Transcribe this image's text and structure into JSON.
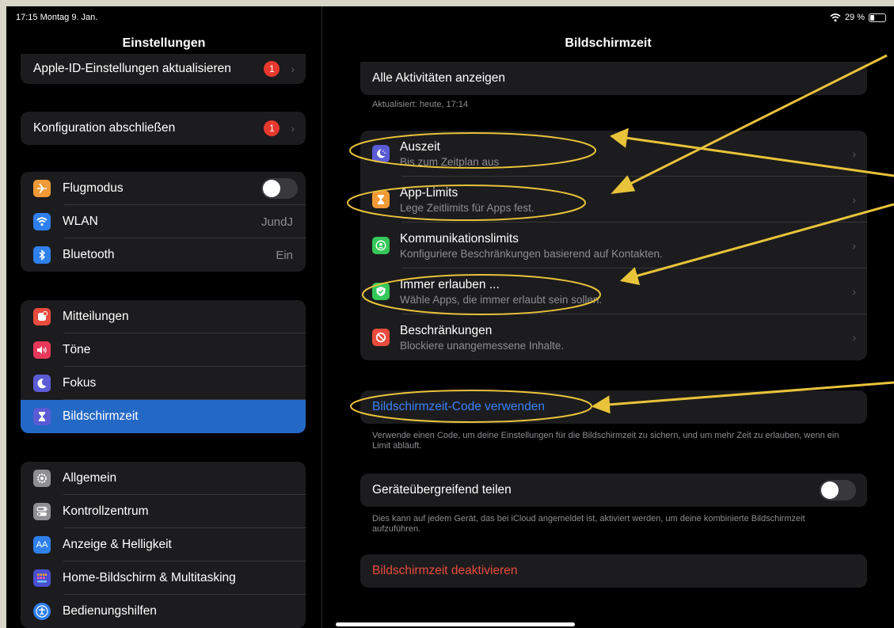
{
  "status": {
    "time": "17:15  Montag 9. Jan.",
    "battery": "29 %",
    "battery_level": 0.29
  },
  "sidebar": {
    "title": "Einstellungen",
    "apple_id": {
      "label": "Apple-ID-Einstellungen aktualisieren",
      "badge": "1"
    },
    "config": {
      "label": "Konfiguration abschließen",
      "badge": "1"
    },
    "connectivity": [
      {
        "label": "Flugmodus",
        "icon": "airplane-icon",
        "color": "#f19a37",
        "value": ""
      },
      {
        "label": "WLAN",
        "icon": "wifi-icon",
        "color": "#2f80ed",
        "value": "JundJ"
      },
      {
        "label": "Bluetooth",
        "icon": "bluetooth-icon",
        "color": "#2f80ed",
        "value": "Ein"
      }
    ],
    "notifications": [
      {
        "label": "Mitteilungen",
        "icon": "bell-icon",
        "color": "#e94b3c"
      },
      {
        "label": "Töne",
        "icon": "speaker-icon",
        "color": "#e9395a"
      },
      {
        "label": "Fokus",
        "icon": "moon-icon",
        "color": "#5b5bd6"
      },
      {
        "label": "Bildschirmzeit",
        "icon": "hourglass-icon",
        "color": "#5b5bd6"
      }
    ],
    "general": [
      {
        "label": "Allgemein",
        "icon": "gear-icon",
        "color": "#8e8e93"
      },
      {
        "label": "Kontrollzentrum",
        "icon": "switches-icon",
        "color": "#8e8e93"
      },
      {
        "label": "Anzeige & Helligkeit",
        "icon": "aa-icon",
        "color": "#2f80ed",
        "glyph": "AA"
      },
      {
        "label": "Home-Bildschirm & Multitasking",
        "icon": "grid-icon",
        "color": "#4a4fd1"
      },
      {
        "label": "Bedienungshilfen",
        "icon": "accessibility-icon",
        "color": "#2f80ed"
      }
    ]
  },
  "main": {
    "title": "Bildschirmzeit",
    "all_activity": "Alle Aktivitäten anzeigen",
    "updated": "Aktualisiert: heute, 17:14",
    "items": [
      {
        "title": "Auszeit",
        "subtitle": "Bis zum Zeitplan aus",
        "icon": "downtime-icon",
        "color": "#5b5bd6"
      },
      {
        "title": "App-Limits",
        "subtitle": "Lege Zeitlimits für Apps fest.",
        "icon": "hourglass-icon",
        "color": "#f19a37"
      },
      {
        "title": "Kommunikationslimits",
        "subtitle": "Konfiguriere Beschränkungen basierend auf Kontakten.",
        "icon": "contact-icon",
        "color": "#34c759"
      },
      {
        "title": "Immer erlauben ...",
        "subtitle": "Wähle Apps, die immer erlaubt sein sollen.",
        "icon": "check-shield-icon",
        "color": "#34c759"
      },
      {
        "title": "Beschränkungen",
        "subtitle": "Blockiere unangemessene Inhalte.",
        "icon": "block-icon",
        "color": "#e94b3c"
      }
    ],
    "code_label": "Bildschirmzeit-Code verwenden",
    "code_footnote": "Verwende einen Code, um deine Einstellungen für die Bildschirmzeit zu sichern, und um mehr Zeit zu erlauben, wenn ein Limit abläuft.",
    "share_label": "Geräteübergreifend teilen",
    "share_footnote": "Dies kann auf jedem Gerät, das bei iCloud angemeldet ist, aktiviert werden, um deine kombinierte Bildschirmzeit aufzuführen.",
    "deactivate_label": "Bildschirmzeit deaktivieren"
  },
  "colors": {
    "accent_blue": "#3a82f7",
    "destructive_red": "#e94b3c",
    "annotation": "#e9c33a"
  }
}
